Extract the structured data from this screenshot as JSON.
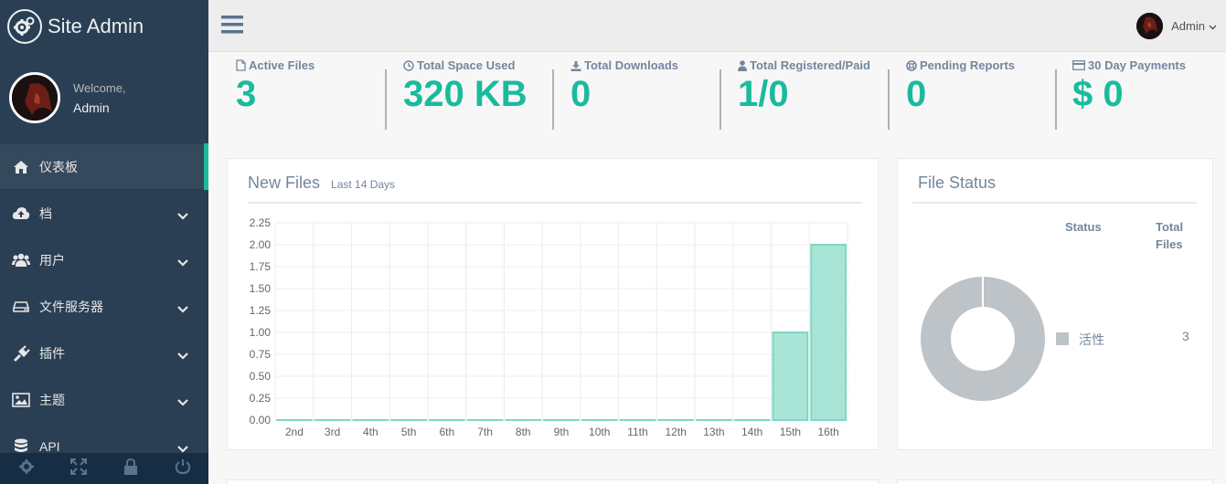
{
  "brand": {
    "title": "Site Admin",
    "logo_icon": "gears-icon"
  },
  "profile": {
    "welcome": "Welcome,",
    "name": "Admin"
  },
  "sidebar": {
    "items": [
      {
        "label": "仪表板",
        "icon": "home-icon",
        "active": true,
        "expandable": false
      },
      {
        "label": "档",
        "icon": "cloud-upload-icon",
        "active": false,
        "expandable": true
      },
      {
        "label": "用户",
        "icon": "users-icon",
        "active": false,
        "expandable": true
      },
      {
        "label": "文件服务器",
        "icon": "hdd-icon",
        "active": false,
        "expandable": true
      },
      {
        "label": "插件",
        "icon": "plug-icon",
        "active": false,
        "expandable": true
      },
      {
        "label": "主题",
        "icon": "image-icon",
        "active": false,
        "expandable": true
      },
      {
        "label": "API",
        "icon": "database-icon",
        "active": false,
        "expandable": true
      }
    ],
    "footer_icons": [
      "gear-icon",
      "fullscreen-icon",
      "lock-icon",
      "power-icon"
    ]
  },
  "topnav": {
    "user_name": "Admin"
  },
  "stats": [
    {
      "label": "Active Files",
      "value": "3",
      "icon": "file-icon"
    },
    {
      "label": "Total Space Used",
      "value": "320 KB",
      "icon": "clock-icon"
    },
    {
      "label": "Total Downloads",
      "value": "0",
      "icon": "download-icon"
    },
    {
      "label": "Total Registered/Paid",
      "value": "1/0",
      "icon": "user-icon"
    },
    {
      "label": "Pending Reports",
      "value": "0",
      "icon": "lifesaver-icon"
    },
    {
      "label": "30 Day Payments",
      "value": "$ 0",
      "icon": "credit-card-icon"
    }
  ],
  "new_files_panel": {
    "title": "New Files",
    "subtitle": "Last 14 Days"
  },
  "file_status_panel": {
    "title": "File Status",
    "col_status": "Status",
    "col_total_line1": "Total",
    "col_total_line2": "Files",
    "legend": [
      {
        "label": "活性",
        "value": "3",
        "color": "#bdc3c7"
      }
    ]
  },
  "colors": {
    "accent": "#1abb9c",
    "sidebar": "#2a3f54",
    "bar_fill": "#a8e4d6",
    "bar_stroke": "#80d6c2",
    "donut": "#bdc3c7"
  },
  "chart_data": [
    {
      "type": "bar",
      "categories": [
        "2nd",
        "3rd",
        "4th",
        "5th",
        "6th",
        "7th",
        "8th",
        "9th",
        "10th",
        "11th",
        "12th",
        "13th",
        "14th",
        "15th",
        "16th"
      ],
      "values": [
        0,
        0,
        0,
        0,
        0,
        0,
        0,
        0,
        0,
        0,
        0,
        0,
        0,
        1,
        2
      ],
      "ylim": [
        0,
        2.25
      ],
      "yticks": [
        "0.00",
        "0.25",
        "0.50",
        "0.75",
        "1.00",
        "1.25",
        "1.50",
        "1.75",
        "2.00",
        "2.25"
      ],
      "grid": true
    },
    {
      "type": "pie",
      "donut": true,
      "categories": [
        "活性"
      ],
      "values": [
        3
      ]
    }
  ]
}
